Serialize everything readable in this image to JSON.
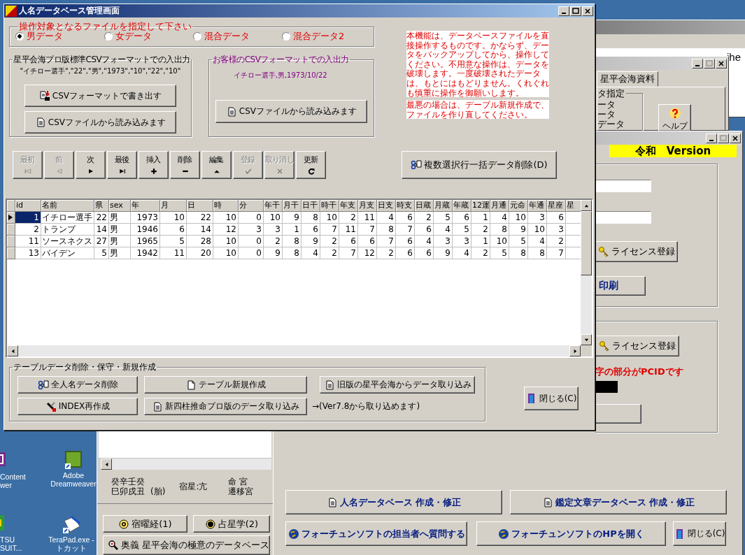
{
  "desktop_icons": [
    {
      "kind": "content",
      "lines": [
        "Content",
        "wer"
      ]
    },
    {
      "kind": "dw",
      "lines": [
        "Adobe",
        "Dreamweaver"
      ]
    },
    {
      "kind": "green",
      "lines": [
        "TSU",
        "SUIT..."
      ]
    },
    {
      "kind": "terapad",
      "lines": [
        "TeraPad.exe -",
        "トカット"
      ]
    }
  ],
  "back_window": {
    "text_fragment": "ihe"
  },
  "data_window": {
    "tab": "星平会海資料",
    "group_label": "タ指定",
    "options": [
      "ータ",
      "ータ",
      "データ"
    ],
    "help_button": "ヘルプ"
  },
  "chart_window": {
    "stems": "癸辛壬癸",
    "branches": "巳卯戌丑",
    "note": "(胎)",
    "star": "宿星:亢",
    "palace": "命 宮",
    "palace_2": "遷移宮",
    "buttons": [
      "宿曜経(1)",
      "占星学(2)",
      "奥義 星平会海の極意のデータベース"
    ]
  },
  "menu_window": {
    "badge": "令和　Version",
    "license_button": "ライセンス登録",
    "print_button": "印刷",
    "license_button_2": "ライセンス登録",
    "pcid_note": "字の部分がPCIDです",
    "buttons": [
      "人名データベース 作成・修正",
      "鑑定文章データベース 作成・修正",
      "フォーチュンソフトの担当者へ質問する",
      "フォーチュンソフトのHPを開く",
      "閉じる(C)"
    ]
  },
  "window": {
    "title": "人名データベース管理画面"
  },
  "file_select": {
    "label": "操作対象となるファイルを指定して下さい",
    "options": [
      {
        "label": "男データ",
        "selected": true
      },
      {
        "label": "女データ",
        "selected": false
      },
      {
        "label": "混合データ",
        "selected": false
      },
      {
        "label": "混合データ2",
        "selected": false
      }
    ]
  },
  "warning": [
    "本機能は、データベースファイルを直接操作するものです。かならず、データをバックアップしてから、操作してください。不用意な操作は、データを破壊します。一度破壊されたデータは、もとにはもどりません。くれぐれも慎重に操作を御願いします。",
    "最悪の場合は、デーブル新規作成で、ファイルを作り直してください。"
  ],
  "standard_csv": {
    "label": "星平会海プロ版標準CSVフォーマットでの入出力",
    "sample": "\"イチロー選手\",\"22\",\"男\",\"1973\",\"10\",\"22\",\"10\"",
    "buttons": [
      "CSVフォーマットで書き出す",
      "CSVファイルから読み込みます"
    ]
  },
  "customer_csv": {
    "label": "お客様のCSVフォーマットでの入出力",
    "sample": "イチロー選手,男,1973/10/22",
    "button": "CSVファイルから読み込みます"
  },
  "navigator": [
    {
      "label": "最初",
      "disabled": true
    },
    {
      "label": "前",
      "disabled": true
    },
    {
      "label": "次",
      "disabled": false
    },
    {
      "label": "最後",
      "disabled": false
    },
    {
      "label": "挿入",
      "disabled": false
    },
    {
      "label": "削除",
      "disabled": false
    },
    {
      "label": "編集",
      "disabled": false
    },
    {
      "label": "登録",
      "disabled": true
    },
    {
      "label": "取り消し",
      "disabled": true
    },
    {
      "label": "更新",
      "disabled": false
    }
  ],
  "bulk_delete_button": "複数選択行一括データ削除(D)",
  "table": {
    "columns": [
      "id",
      "名前",
      "県",
      "sex",
      "年",
      "月",
      "日",
      "時",
      "分",
      "年干",
      "月干",
      "日干",
      "時干",
      "年支",
      "月支",
      "日支",
      "時支",
      "日蔵",
      "月蔵",
      "年蔵",
      "12運",
      "月通",
      "元命",
      "年通",
      "星座",
      "星"
    ],
    "rows": [
      {
        "selected": true,
        "cells": [
          "1",
          "イチロー選手",
          "22",
          "男",
          "1973",
          "10",
          "22",
          "10",
          "0",
          "10",
          "9",
          "8",
          "10",
          "2",
          "11",
          "4",
          "6",
          "2",
          "5",
          "6",
          "1",
          "4",
          "10",
          "3",
          "6"
        ]
      },
      {
        "selected": false,
        "cells": [
          "2",
          "トランプ",
          "14",
          "男",
          "1946",
          "6",
          "14",
          "12",
          "3",
          "3",
          "1",
          "6",
          "7",
          "11",
          "7",
          "8",
          "7",
          "6",
          "4",
          "5",
          "2",
          "8",
          "9",
          "10",
          "3"
        ]
      },
      {
        "selected": false,
        "cells": [
          "11",
          "ソースネクス",
          "27",
          "男",
          "1965",
          "5",
          "28",
          "10",
          "0",
          "2",
          "8",
          "9",
          "2",
          "6",
          "6",
          "7",
          "6",
          "4",
          "3",
          "3",
          "1",
          "10",
          "5",
          "4",
          "2"
        ]
      },
      {
        "selected": false,
        "cells": [
          "13",
          "バイデン",
          "5",
          "男",
          "1942",
          "11",
          "20",
          "10",
          "0",
          "9",
          "8",
          "4",
          "2",
          "7",
          "12",
          "2",
          "6",
          "6",
          "9",
          "4",
          "2",
          "5",
          "8",
          "8",
          "7"
        ]
      }
    ]
  },
  "maintenance": {
    "label": "テーブルデータ削除・保守・新規作成",
    "buttons": [
      "全人名データ削除",
      "テーブル新規作成",
      "旧版の星平会海からデータ取り込み",
      "INDEX再作成",
      "新四柱推命プロ版のデータ取り込み"
    ],
    "note": "→(Ver7.8から取り込めます)",
    "close_button": "閉じる(C)"
  }
}
